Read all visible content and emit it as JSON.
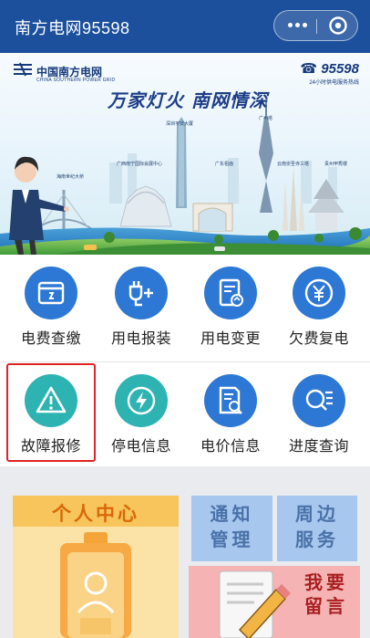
{
  "header": {
    "title": "南方电网95598",
    "more_icon": "more-dots-icon",
    "close_icon": "target-circle-icon",
    "bar_color": "#1c4f9c"
  },
  "banner": {
    "brand_cn": "中国南方电网",
    "brand_en": "CHINA SOUTHERN POWER GRID",
    "hotline_number": "95598",
    "hotline_sub": "24小时供电服务热线",
    "slogan": "万家灯火  南网情深",
    "landmarks": [
      "深圳平安大厦",
      "广州塔",
      "广西南宁国际会展中心",
      "广东祖庙",
      "云南崇圣寺三塔",
      "贵州甲秀楼",
      "海南世纪大桥"
    ]
  },
  "services": [
    {
      "label": "电费查缴",
      "icon": "bill-card-icon",
      "color": "#2d78d4"
    },
    {
      "label": "用电报装",
      "icon": "plug-add-icon",
      "color": "#2d78d4"
    },
    {
      "label": "用电变更",
      "icon": "document-change-icon",
      "color": "#2d78d4"
    },
    {
      "label": "欠费复电",
      "icon": "yen-coin-icon",
      "color": "#2d78d4"
    },
    {
      "label": "故障报修",
      "icon": "warning-triangle-icon",
      "color": "#2eb3b3"
    },
    {
      "label": "停电信息",
      "icon": "lightning-icon",
      "color": "#2eb3b3"
    },
    {
      "label": "电价信息",
      "icon": "document-search-icon",
      "color": "#2d78d4"
    },
    {
      "label": "进度查询",
      "icon": "search-list-icon",
      "color": "#2d78d4"
    }
  ],
  "cards": {
    "personal": "个人中心",
    "notice": [
      "通知",
      "管理"
    ],
    "nearby": [
      "周边",
      "服务"
    ],
    "message": [
      "我要",
      "留言"
    ]
  },
  "highlight_color": "#e02323"
}
